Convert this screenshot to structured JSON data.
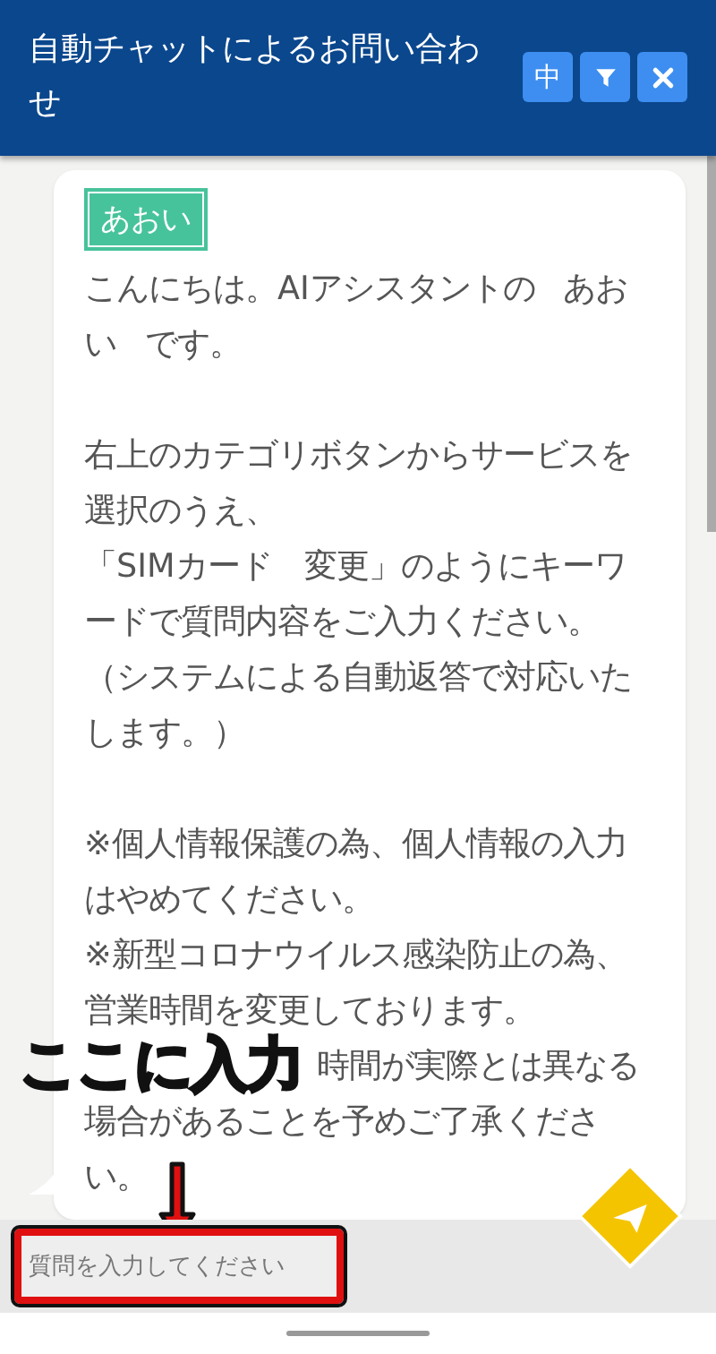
{
  "header": {
    "title": "自動チャットによるお問い合わせ",
    "buttons": [
      {
        "kind": "text",
        "label": "中"
      },
      {
        "kind": "filter"
      },
      {
        "kind": "close"
      }
    ]
  },
  "message": {
    "sender": "あおい",
    "paragraphs": [
      [
        {
          "kind": "plain",
          "text": "こんにちは。AIアシスタントの あおい です。"
        }
      ],
      [
        {
          "kind": "plain",
          "text": "右上のカテゴリボタンからサービスを選択のうえ、"
        },
        {
          "kind": "plain",
          "text": "「SIMカード　変更」のようにキーワードで質問内容をご入力ください。"
        },
        {
          "kind": "plain",
          "text": "（システムによる自動返答で対応いたします。）"
        }
      ],
      [
        {
          "kind": "plain",
          "text": "※個人情報保護の為、個人情報の入力はやめてください。"
        },
        {
          "kind": "plain",
          "text": "※新型コロナウイルス感染防止の為、営業時間を変更しております。"
        },
        {
          "kind": "covered",
          "text": "時間が実際とは異なる"
        },
        {
          "kind": "plain",
          "text": "場合があることを予めご了承くださ"
        },
        {
          "kind": "plain",
          "text": "い。"
        }
      ]
    ]
  },
  "annotation": {
    "label": "ここに入力"
  },
  "input": {
    "placeholder": "質問を入力してください"
  }
}
